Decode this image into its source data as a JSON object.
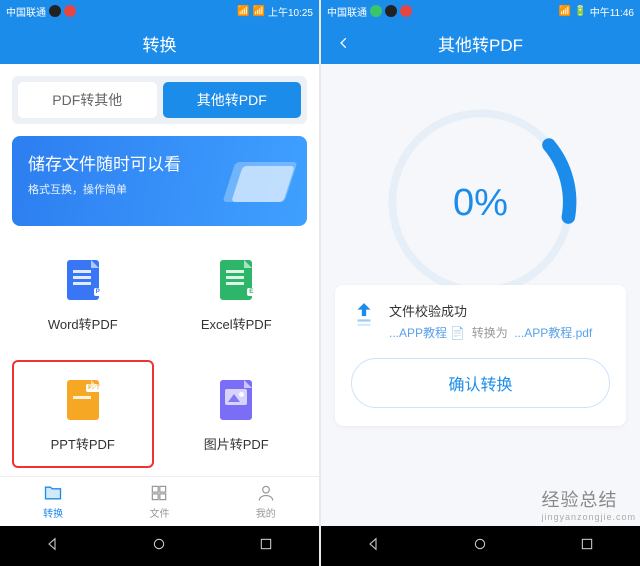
{
  "left": {
    "status": {
      "carrier": "中国联通",
      "time": "上午10:25"
    },
    "header": {
      "title": "转换"
    },
    "tabs": {
      "a": "PDF转其他",
      "b": "其他转PDF"
    },
    "banner": {
      "line1": "储存文件随时可以看",
      "line2": "格式互换，操作简单"
    },
    "cards": {
      "word": "Word转PDF",
      "excel": "Excel转PDF",
      "ppt": "PPT转PDF",
      "image": "图片转PDF"
    },
    "nav": {
      "a": "转换",
      "b": "文件",
      "c": "我的"
    }
  },
  "right": {
    "status": {
      "carrier": "中国联通",
      "time": "中午11:46"
    },
    "header": {
      "title": "其他转PDF"
    },
    "progress": {
      "pct": "0%"
    },
    "info": {
      "title": "文件校验成功",
      "from": "...APP教程 📄",
      "mid": "转换为",
      "to": "...APP教程.pdf"
    },
    "confirm": "确认转换"
  },
  "watermark": {
    "main": "经验总结",
    "sub": "jingyanzongjie.com"
  }
}
